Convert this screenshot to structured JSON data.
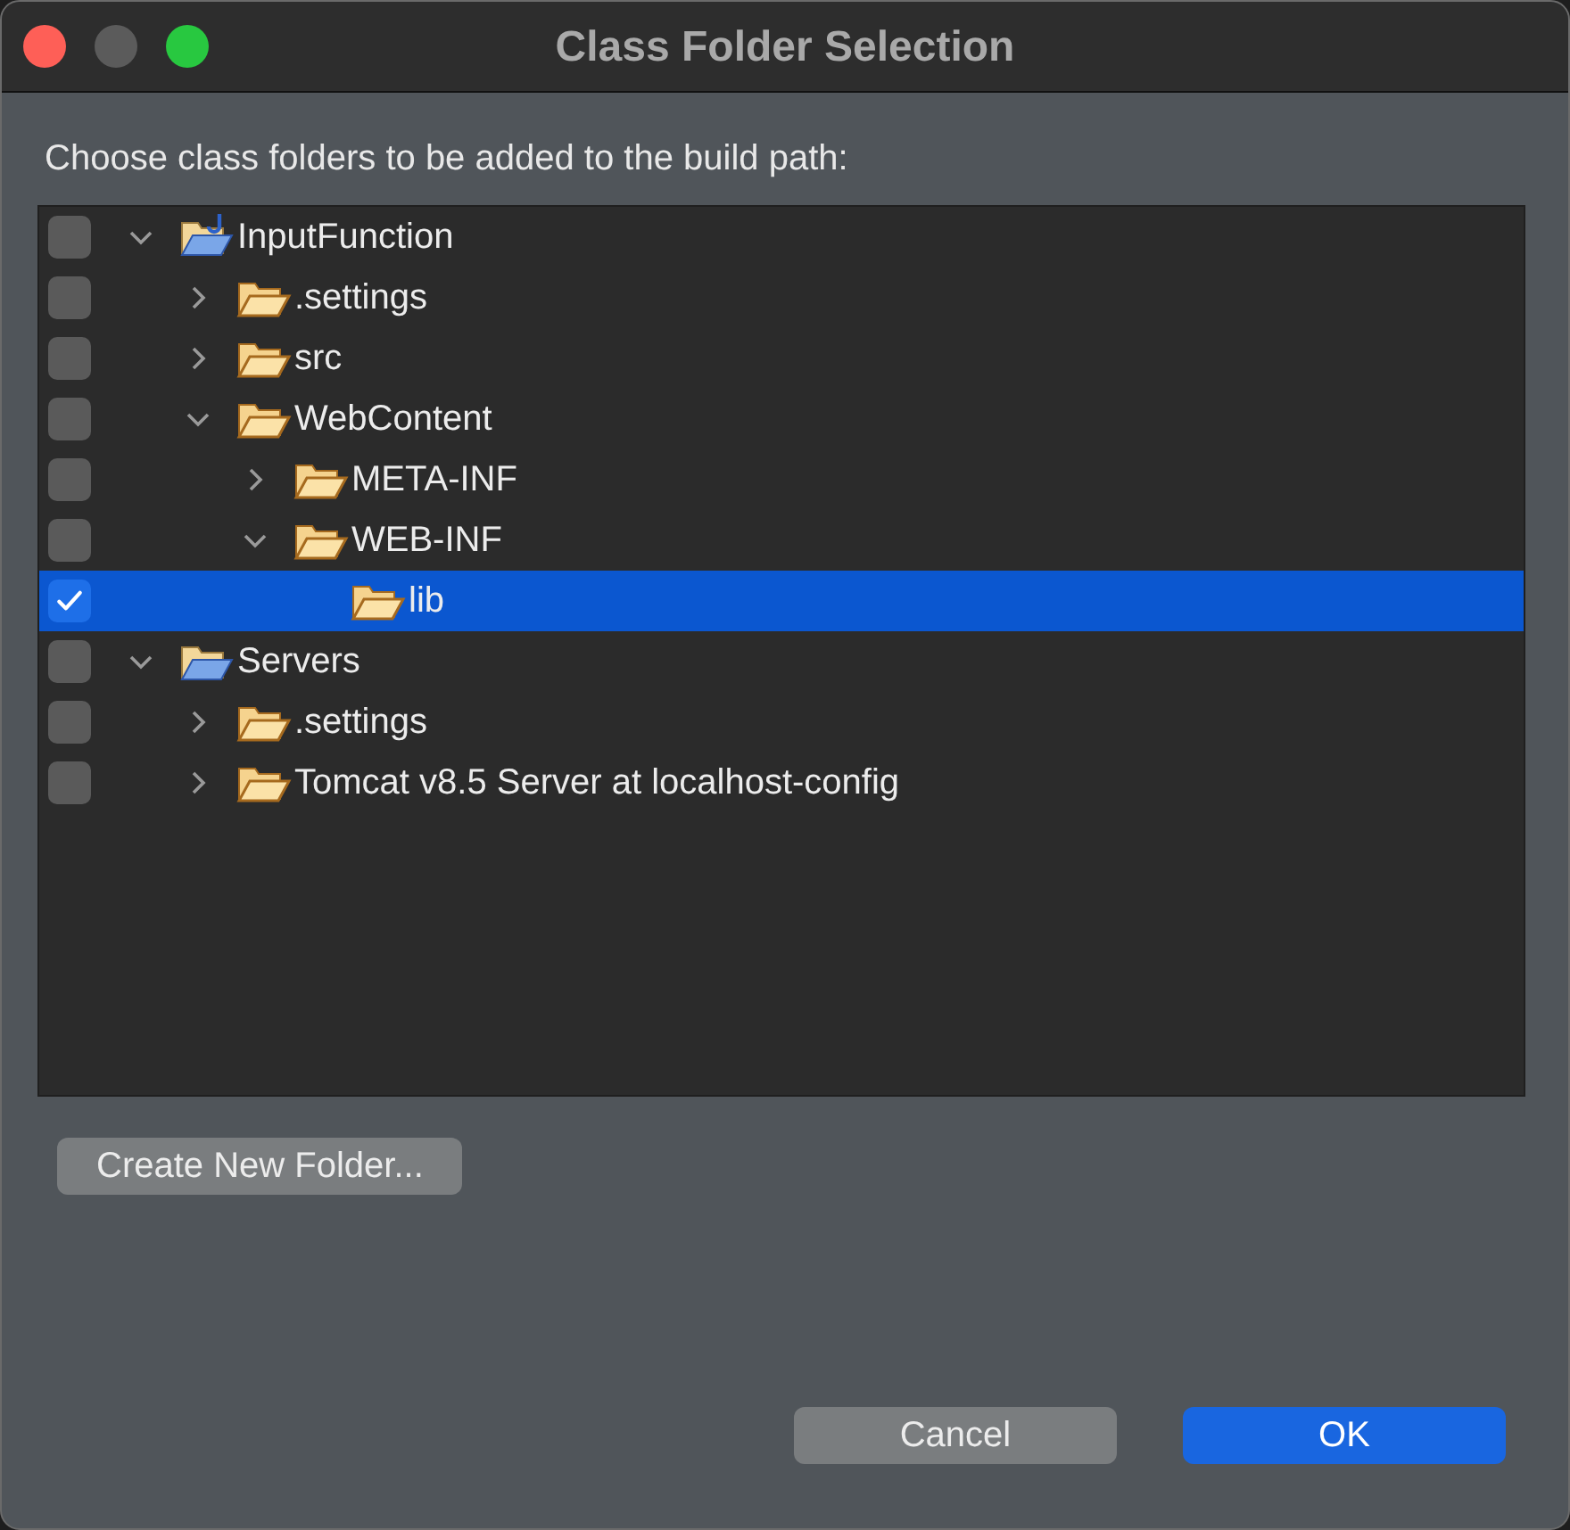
{
  "window": {
    "title": "Class Folder Selection"
  },
  "prompt": "Choose class folders to be added to the build path:",
  "tree": [
    {
      "label": "InputFunction",
      "kind": "java_project",
      "checked": false,
      "selected": false,
      "expanded": true,
      "children": [
        {
          "label": ".settings",
          "kind": "folder",
          "checked": false,
          "selected": false,
          "expanded": false
        },
        {
          "label": "src",
          "kind": "folder",
          "checked": false,
          "selected": false,
          "expanded": false
        },
        {
          "label": "WebContent",
          "kind": "folder",
          "checked": false,
          "selected": false,
          "expanded": true,
          "children": [
            {
              "label": "META-INF",
              "kind": "folder",
              "checked": false,
              "selected": false,
              "expanded": false
            },
            {
              "label": "WEB-INF",
              "kind": "folder",
              "checked": false,
              "selected": false,
              "expanded": true,
              "children": [
                {
                  "label": "lib",
                  "kind": "leaf_folder",
                  "checked": true,
                  "selected": true
                }
              ]
            }
          ]
        }
      ]
    },
    {
      "label": "Servers",
      "kind": "project",
      "checked": false,
      "selected": false,
      "expanded": true,
      "children": [
        {
          "label": ".settings",
          "kind": "folder",
          "checked": false,
          "selected": false,
          "expanded": false
        },
        {
          "label": "Tomcat v8.5 Server at localhost-config",
          "kind": "folder",
          "checked": false,
          "selected": false,
          "expanded": false
        }
      ]
    }
  ],
  "create_button": "Create New Folder...",
  "buttons": [
    {
      "label": "Cancel",
      "kind": "secondary"
    },
    {
      "label": "OK",
      "kind": "primary"
    }
  ]
}
